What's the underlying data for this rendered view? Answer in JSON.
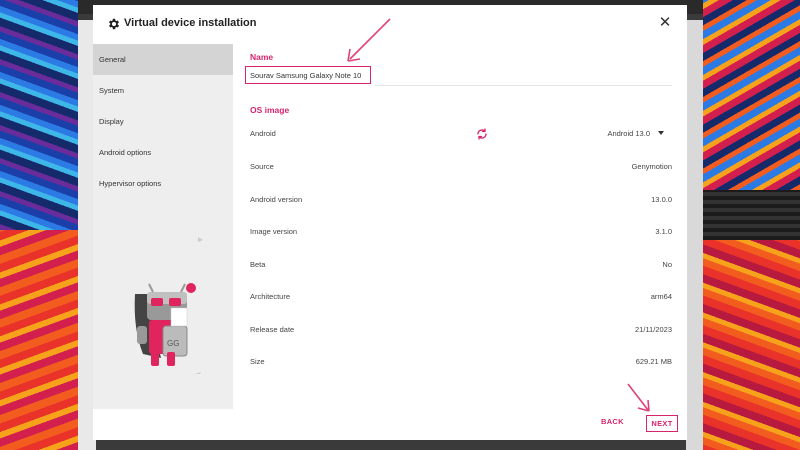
{
  "dialog": {
    "title": "Virtual device installation",
    "close_icon": "close-icon",
    "title_icon": "gear-icon"
  },
  "sidebar": {
    "items": [
      {
        "label": "General",
        "active": true
      },
      {
        "label": "System",
        "active": false
      },
      {
        "label": "Display",
        "active": false
      },
      {
        "label": "Android options",
        "active": false
      },
      {
        "label": "Hypervisor options",
        "active": false
      }
    ]
  },
  "name_section": {
    "title": "Name",
    "value": "Sourav Samsung Galaxy Note 10"
  },
  "os_section": {
    "title": "OS image",
    "rows": [
      {
        "label": "Android",
        "value": "Android 13.0"
      },
      {
        "label": "Source",
        "value": "Genymotion"
      },
      {
        "label": "Android version",
        "value": "13.0.0"
      },
      {
        "label": "Image version",
        "value": "3.1.0"
      },
      {
        "label": "Beta",
        "value": "No"
      },
      {
        "label": "Architecture",
        "value": "arm64"
      },
      {
        "label": "Release date",
        "value": "21/11/2023"
      },
      {
        "label": "Size",
        "value": "629.21 MB"
      }
    ]
  },
  "footer": {
    "back_label": "BACK",
    "next_label": "NEXT"
  },
  "colors": {
    "accent": "#d6246e",
    "sidebar_bg": "#eeeeee",
    "sidebar_active": "#d4d4d4",
    "annotation": "#e0407a"
  }
}
